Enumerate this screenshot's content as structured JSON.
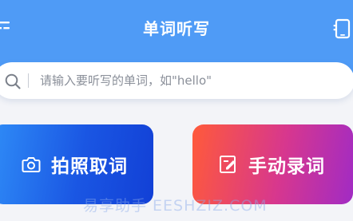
{
  "header": {
    "title": "单词听写",
    "menu_icon": "menu-lines-icon",
    "right_icon": "phone-icon",
    "background_color": "#4f9bf6"
  },
  "search": {
    "placeholder": "请输入要听写的单词，如\"hello\"",
    "icon": "search-icon"
  },
  "cards": [
    {
      "label": "拍照取词",
      "icon": "camera-icon",
      "gradient_start": "#2f8cf7",
      "gradient_end": "#1240d6"
    },
    {
      "label": "手动录词",
      "icon": "edit-document-icon",
      "gradient_start": "#ff5a3a",
      "gradient_end": "#a12bc4"
    }
  ],
  "watermark": "易享助手 EESHZIZ.COM"
}
